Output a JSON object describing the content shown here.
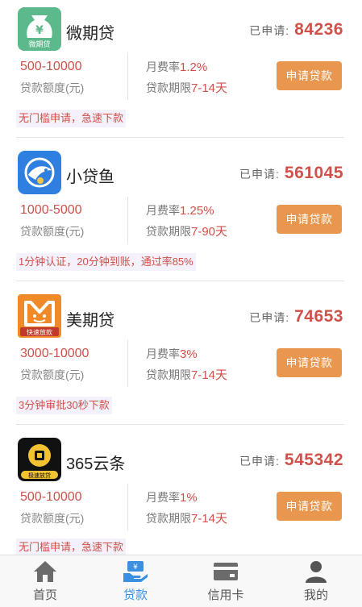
{
  "loans": [
    {
      "name": "微期贷",
      "logo": "weiqidai-logo",
      "logo_text": "微期贷",
      "applied_label": "已申请:",
      "applied_count": "84236",
      "amount": "500-10000",
      "amount_label": "贷款额度(元)",
      "rate_label": "月费率",
      "rate": "1.2%",
      "term_label": "贷款期限",
      "term": "7-14天",
      "button": "申请贷款",
      "tag": "无门槛申请，急速下款"
    },
    {
      "name": "小贷鱼",
      "logo": "xiaodaiyu-logo",
      "applied_label": "已申请:",
      "applied_count": "561045",
      "amount": "1000-5000",
      "amount_label": "贷款额度(元)",
      "rate_label": "月费率",
      "rate": "1.25%",
      "term_label": "贷款期限",
      "term": "7-90天",
      "button": "申请贷款",
      "tag": "1分钟认证，20分钟到账，通过率85%"
    },
    {
      "name": "美期贷",
      "logo": "meiqidai-logo",
      "logo_text": "快速放款",
      "applied_label": "已申请:",
      "applied_count": "74653",
      "amount": "3000-10000",
      "amount_label": "贷款额度(元)",
      "rate_label": "月费率",
      "rate": "3%",
      "term_label": "贷款期限",
      "term": "7-14天",
      "button": "申请贷款",
      "tag": "3分钟审批30秒下款"
    },
    {
      "name": "365云条",
      "logo": "365yuntiao-logo",
      "logo_text": "极速放贷",
      "applied_label": "已申请:",
      "applied_count": "545342",
      "amount": "500-10000",
      "amount_label": "贷款额度(元)",
      "rate_label": "月费率",
      "rate": "1%",
      "term_label": "贷款期限",
      "term": "7-14天",
      "button": "申请贷款",
      "tag": "无门槛申请，急速下款"
    }
  ],
  "tabbar": {
    "tabs": [
      {
        "label": "首页",
        "icon": "home-icon"
      },
      {
        "label": "贷款",
        "icon": "loan-icon",
        "active": true
      },
      {
        "label": "信用卡",
        "icon": "credit-card-icon"
      },
      {
        "label": "我的",
        "icon": "user-icon"
      }
    ]
  },
  "colors": {
    "accent_red": "#d0504a",
    "button_orange": "#e9964f",
    "active_tab_blue": "#3d8fe0"
  }
}
